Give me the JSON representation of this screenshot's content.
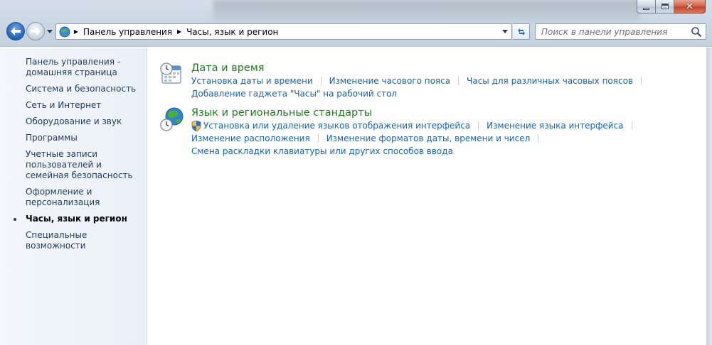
{
  "titlebar": {
    "controls": {
      "minimize": "minimize",
      "maximize": "maximize",
      "close": "close"
    }
  },
  "navigation": {
    "breadcrumb": [
      "Панель управления",
      "Часы, язык и регион"
    ],
    "search_placeholder": "Поиск в панели управления"
  },
  "sidebar": {
    "items": [
      {
        "label": "Панель управления - домашняя страница",
        "current": false
      },
      {
        "label": "Система и безопасность",
        "current": false
      },
      {
        "label": "Сеть и Интернет",
        "current": false
      },
      {
        "label": "Оборудование и звук",
        "current": false
      },
      {
        "label": "Программы",
        "current": false
      },
      {
        "label": "Учетные записи пользователей и семейная безопасность",
        "current": false
      },
      {
        "label": "Оформление и персонализация",
        "current": false
      },
      {
        "label": "Часы, язык и регион",
        "current": true
      },
      {
        "label": "Специальные возможности",
        "current": false
      }
    ]
  },
  "main": {
    "categories": [
      {
        "title": "Дата и время",
        "icon": "calendar-clock-icon",
        "links": [
          "Установка даты и времени",
          "Изменение часового пояса",
          "Часы для различных часовых поясов",
          "Добавление гаджета \"Часы\" на рабочий стол"
        ]
      },
      {
        "title": "Язык и региональные стандарты",
        "icon": "globe-clock-icon",
        "links": [
          "Установка или удаление языков отображения интерфейса",
          "Изменение языка интерфейса",
          "Изменение расположения",
          "Изменение форматов даты, времени и чисел",
          "Смена раскладки клавиатуры или других способов ввода"
        ]
      }
    ]
  },
  "colors": {
    "link": "#1662b4",
    "category_title": "#1d7d1d",
    "sidebar_text": "#1e395b",
    "close_button": "#c4452b"
  }
}
